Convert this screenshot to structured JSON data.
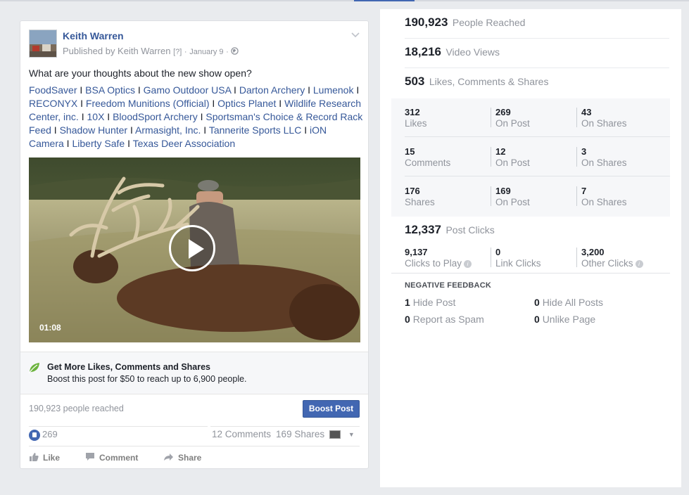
{
  "post": {
    "author": "Keith Warren",
    "published_prefix": "Published by Keith Warren",
    "help_mark": "[?]",
    "dot": "·",
    "date": "January 9",
    "dot2": "·",
    "globe_icon": "globe-icon",
    "text": "What are your thoughts about the new show open?",
    "tags": [
      "FoodSaver",
      "BSA Optics",
      "Gamo Outdoor USA",
      "Darton Archery",
      "Lumenok",
      "RECONYX",
      "Freedom Munitions (Official)",
      "Optics Planet",
      "Wildlife Research Center, inc.",
      "10X",
      "BloodSport Archery",
      "Sportsman's Choice & Record Rack Feed",
      "Shadow Hunter",
      "Armasight, Inc.",
      "Tannerite Sports LLC",
      "iON Camera",
      "Liberty Safe",
      "Texas Deer Association"
    ],
    "tag_separator": "I",
    "video_duration": "01:08"
  },
  "boost": {
    "title": "Get More Likes, Comments and Shares",
    "subtitle": "Boost this post for $50 to reach up to 6,900 people.",
    "reached": "190,923 people reached",
    "button": "Boost Post"
  },
  "reactions": {
    "likes": "269",
    "comments": "12 Comments",
    "shares": "169 Shares"
  },
  "actions": {
    "like": "Like",
    "comment": "Comment",
    "share": "Share"
  },
  "insights": {
    "reached": {
      "value": "190,923",
      "label": "People Reached"
    },
    "views": {
      "value": "18,216",
      "label": "Video Views"
    },
    "engagement": {
      "value": "503",
      "label": "Likes, Comments & Shares"
    },
    "grid": [
      [
        {
          "n": "312",
          "t": "Likes"
        },
        {
          "n": "269",
          "t": "On Post"
        },
        {
          "n": "43",
          "t": "On Shares"
        }
      ],
      [
        {
          "n": "15",
          "t": "Comments"
        },
        {
          "n": "12",
          "t": "On Post"
        },
        {
          "n": "3",
          "t": "On Shares"
        }
      ],
      [
        {
          "n": "176",
          "t": "Shares"
        },
        {
          "n": "169",
          "t": "On Post"
        },
        {
          "n": "7",
          "t": "On Shares"
        }
      ]
    ],
    "clicks": {
      "value": "12,337",
      "label": "Post Clicks"
    },
    "click_breakdown": [
      {
        "n": "9,137",
        "t": "Clicks to Play"
      },
      {
        "n": "0",
        "t": "Link Clicks"
      },
      {
        "n": "3,200",
        "t": "Other Clicks"
      }
    ],
    "negative_title": "NEGATIVE FEEDBACK",
    "negative": [
      {
        "n": "1",
        "t": "Hide Post"
      },
      {
        "n": "0",
        "t": "Hide All Posts"
      },
      {
        "n": "0",
        "t": "Report as Spam"
      },
      {
        "n": "0",
        "t": "Unlike Page"
      }
    ]
  }
}
